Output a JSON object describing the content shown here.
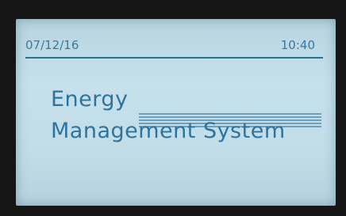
{
  "header": {
    "date": "07/12/16",
    "time": "10:40"
  },
  "main": {
    "title_line1": "Energy",
    "title_line2": "Management System"
  },
  "colors": {
    "lcd_background": "#c3dfea",
    "text": "#2f739c",
    "bezel": "#161616"
  }
}
